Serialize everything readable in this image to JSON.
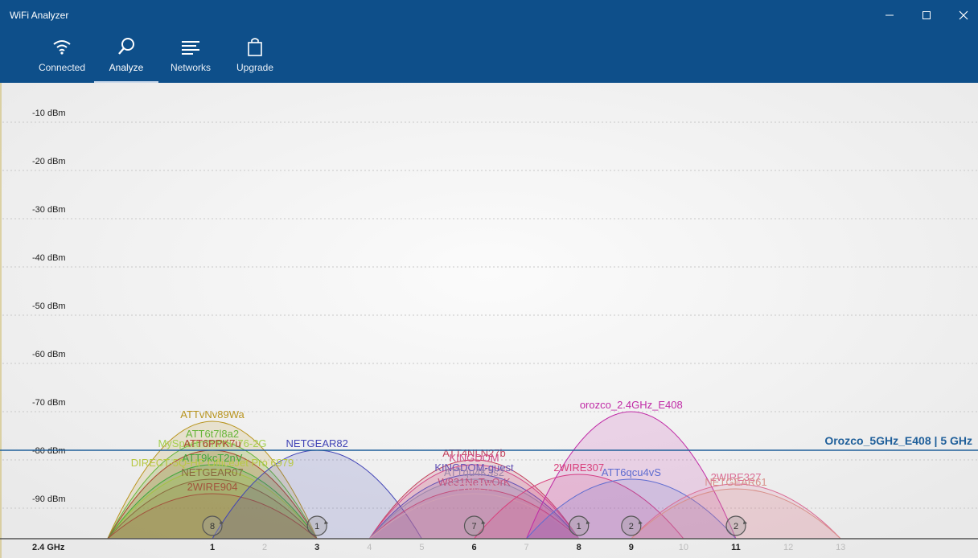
{
  "window": {
    "title": "WiFi Analyzer",
    "controls": [
      {
        "name": "minimize-button",
        "icon": "minimize-icon"
      },
      {
        "name": "maximize-button",
        "icon": "maximize-icon"
      },
      {
        "name": "close-button",
        "icon": "close-icon"
      }
    ]
  },
  "nav": {
    "items": [
      {
        "label": "Connected",
        "icon": "wifi-icon",
        "active": false
      },
      {
        "label": "Analyze",
        "icon": "analyze-icon",
        "active": true
      },
      {
        "label": "Networks",
        "icon": "networks-icon",
        "active": false
      },
      {
        "label": "Upgrade",
        "icon": "shopping-bag-icon",
        "active": false
      }
    ]
  },
  "chart_data": {
    "type": "area",
    "band_label": "2.4 GHz",
    "y_ticks": [
      -10,
      -20,
      -30,
      -40,
      -50,
      -60,
      -70,
      -80,
      -90
    ],
    "y_tick_labels": [
      "-10 dBm",
      "-20 dBm",
      "-30 dBm",
      "-40 dBm",
      "-50 dBm",
      "-60 dBm",
      "-70 dBm",
      "-80 dBm",
      "-90 dBm"
    ],
    "ylim": [
      -100,
      -5
    ],
    "x_ticks": [
      1,
      2,
      3,
      4,
      5,
      6,
      7,
      8,
      9,
      10,
      11,
      12,
      13
    ],
    "x_ticks_emphasized": [
      1,
      3,
      6,
      8,
      9,
      11
    ],
    "channel_badges": [
      {
        "channel": 1,
        "count": "8"
      },
      {
        "channel": 3,
        "count": "1"
      },
      {
        "channel": 6,
        "count": "7"
      },
      {
        "channel": 8,
        "count": "1"
      },
      {
        "channel": 9,
        "count": "2"
      },
      {
        "channel": 11,
        "count": "2"
      }
    ],
    "reference_line": {
      "label": "Orozco_5GHz_E408 | 5 GHz",
      "dbm": -78,
      "color": "#1f5f9a"
    },
    "series": [
      {
        "name": "ATTvNv89Wa",
        "channel": 1,
        "dbm": -74,
        "color": "#b8941e"
      },
      {
        "name": "ATT6t7l8a2",
        "channel": 1,
        "dbm": -78,
        "color": "#66b53a"
      },
      {
        "name": "MySpectrumWiFi76-2G",
        "channel": 1,
        "dbm": -80,
        "color": "#a4cf50"
      },
      {
        "name": "ATT6PPK7u",
        "channel": 1,
        "dbm": -80,
        "color": "#b0443a"
      },
      {
        "name": "DIRECT-5Q-HP OfficeJet Pro 6979",
        "channel": 1,
        "dbm": -84,
        "color": "#b8c843"
      },
      {
        "name": "ATT9kcT2nV",
        "channel": 1,
        "dbm": -83,
        "color": "#44a83e"
      },
      {
        "name": "NETGEAR07",
        "channel": 1,
        "dbm": -86,
        "color": "#8a6a3e"
      },
      {
        "name": "2WIRE904",
        "channel": 1,
        "dbm": -89,
        "color": "#a2533c"
      },
      {
        "name": "NETGEAR82",
        "channel": 3,
        "dbm": -80,
        "color": "#4144b6"
      },
      {
        "name": "ATT4NLN27b",
        "channel": 6,
        "dbm": -82,
        "color": "#c2405c"
      },
      {
        "name": "KINGDOM",
        "channel": 6,
        "dbm": -83,
        "color": "#d34a88"
      },
      {
        "name": "KINGDOM-guest",
        "channel": 6,
        "dbm": -85,
        "color": "#6252b4"
      },
      {
        "name": "ATTqu4K3s2",
        "channel": 6,
        "dbm": -86,
        "color": "#9a86a8"
      },
      {
        "name": "W831NeTwOrK",
        "channel": 6,
        "dbm": -88,
        "color": "#c2507c"
      },
      {
        "name": "ATT8cE7Is",
        "channel": 6,
        "dbm": -89,
        "color": "#d0a0b4"
      },
      {
        "name": "2WIRE307",
        "channel": 8,
        "dbm": -85,
        "color": "#d8407c"
      },
      {
        "name": "orozco_2.4GHz_E408",
        "channel": 9,
        "dbm": -72,
        "color": "#c02aa6"
      },
      {
        "name": "ATT6qcu4vS",
        "channel": 9,
        "dbm": -86,
        "color": "#5e6cd0"
      },
      {
        "name": "2WIRE327",
        "channel": 11,
        "dbm": -87,
        "color": "#da6c94"
      },
      {
        "name": "NETGEAR61",
        "channel": 11,
        "dbm": -88,
        "color": "#d8908a"
      }
    ]
  }
}
